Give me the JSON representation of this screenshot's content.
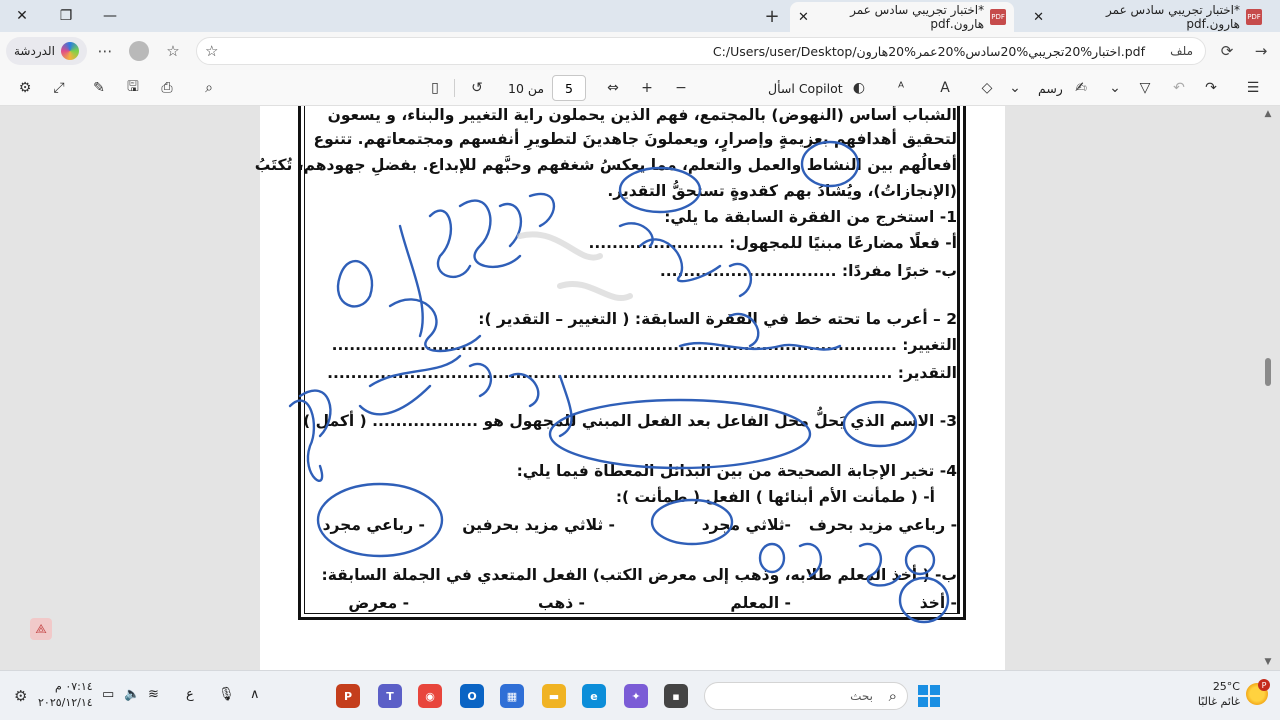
{
  "window": {
    "close_glyph": "✕",
    "restore_glyph": "❐",
    "minimize_glyph": "—"
  },
  "tabs": [
    {
      "title": "*اختبار تجريبي سادس عمر هارون.pdf",
      "active": false
    },
    {
      "title": "*اختبار تجريبي سادس عمر هارون.pdf",
      "active": true
    }
  ],
  "address": {
    "chat_label": "الدردشة",
    "file_label": "ملف",
    "url": "C:/Users/user/Desktop/اختبار%20تجريبي%20سادس%20عمر%20هارون.pdf"
  },
  "pdf_toolbar": {
    "ask_copilot": "اسأل Copilot",
    "draw_label": "رسم",
    "page_current": "5",
    "page_of": "من 10"
  },
  "document": {
    "lines": [
      "الشباب أساس (النهوض) بالمجتمع، فهم الذين يحملون راية التغيير والبناء، و يسعون",
      "لتحقيق أهدافهم بعزيمةٍ وإصرارٍ، ويعملونَ جاهدينَ لتطويرِ أنفسهم ومجتمعاتهم. تتنوع",
      "أفعالُهم بين النشاط والعمل والتعلم، مما يعكسُ شغفهم وحبَّهم للإبداع. بفضلِ جهودهم، تُكتَبُ",
      "(الإنجازاتُ)، ويُشادُ بهم كقدوةٍ تستحقُّ التقدير.",
      "1- استخرج من الفقرة السابقة ما يلي:",
      "أ- فعلًا مضارعًا مبنيًا للمجهول: .......................",
      "ب- خبرًا مفردًا: ..............................",
      "2 – أعرب ما تحته خط في الفقرة السابقة: ( التغيير – التقدير ):",
      "التغيير: ................................................................................................",
      "التقدير: ................................................................................................",
      "3- الاسم الذي يَحلُّ محل الفاعل بعد الفعل المبني للمجهول هو .................. ( أكمل )",
      "4- تخير الإجابة الصحيحة من بين البدائل المعطاة فيما يلي:",
      "أ- ( طمأنت الأم أبنائها ) الفعل ( طمأنت ):",
      "ب- ( أخذ المعلم طلابه، وذهب إلى معرض الكتب) الفعل المتعدي في الجملة السابقة:"
    ],
    "options_a": [
      "- رباعي مزيد بحرف",
      "-ثلاثي مجرد",
      "- ثلاثي مزيد بحرفين",
      "- رباعي مجرد"
    ],
    "options_b": [
      "- أخذ",
      "- المعلم",
      "- ذهب",
      "- معرض"
    ]
  },
  "taskbar": {
    "temperature": "25°C",
    "weather_text": "غائم غالبًا",
    "notif_count": "P",
    "search_placeholder": "بحث",
    "time": "٠٧:١٤ م",
    "date": "٢٠٢٥/١٢/١٤",
    "lang": "ع"
  },
  "colors": {
    "ink": "#2f5fb8",
    "pdf_red": "#c64b4b",
    "accent": "#1a8fe3"
  }
}
